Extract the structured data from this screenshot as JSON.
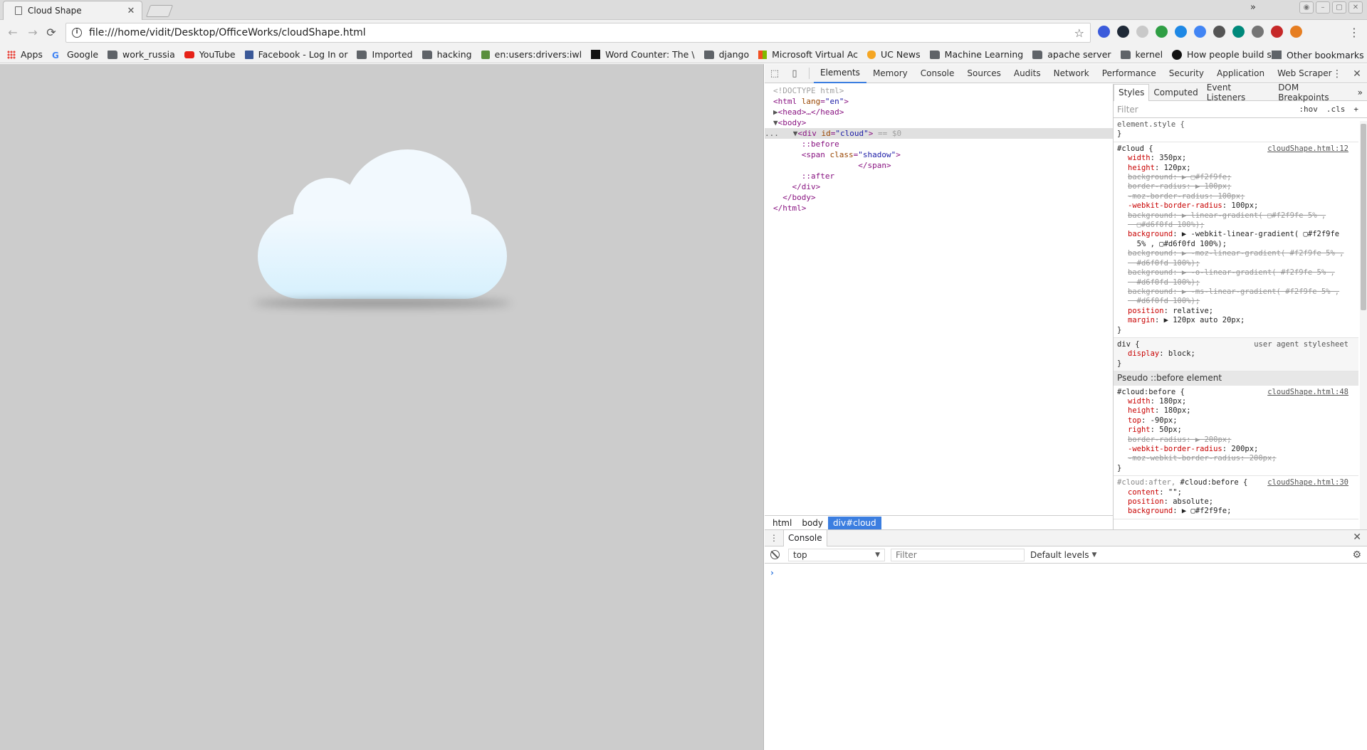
{
  "browser": {
    "tab_title": "Cloud Shape",
    "tab_close_glyph": "✕",
    "url": "file:///home/vidit/Desktop/OfficeWorks/cloudShape.html",
    "back_glyph": "←",
    "forward_glyph": "→",
    "reload_glyph": "⟳",
    "star_glyph": "☆",
    "menu_glyph": "⋮",
    "window_controls": [
      "◉",
      "–",
      "▢",
      "✕"
    ],
    "extension_colors": [
      "#3b5bdb",
      "#1f2937",
      "#c9c9c9",
      "#2f9e44",
      "#1e88e5",
      "#4285f4",
      "#555555",
      "#00897b",
      "#757575",
      "#c62828",
      "#e67e22"
    ]
  },
  "bookmarks": {
    "items": [
      {
        "label": "Apps",
        "icon": "apps-icon"
      },
      {
        "label": "Google",
        "icon": "google-icon"
      },
      {
        "label": "work_russia",
        "icon": "folder-icon"
      },
      {
        "label": "YouTube",
        "icon": "youtube-icon"
      },
      {
        "label": "Facebook - Log In or",
        "icon": "facebook-icon"
      },
      {
        "label": "Imported",
        "icon": "folder-icon"
      },
      {
        "label": "hacking",
        "icon": "folder-icon"
      },
      {
        "label": "en:users:drivers:iwl",
        "icon": "wiki-icon"
      },
      {
        "label": "Word Counter: The \\",
        "icon": "wordcounter-icon"
      },
      {
        "label": "django",
        "icon": "folder-icon"
      },
      {
        "label": "Microsoft Virtual Ac",
        "icon": "microsoft-icon"
      },
      {
        "label": "UC News",
        "icon": "ucnews-icon"
      },
      {
        "label": "Machine Learning",
        "icon": "folder-icon"
      },
      {
        "label": "apache server",
        "icon": "folder-icon"
      },
      {
        "label": "kernel",
        "icon": "folder-icon"
      },
      {
        "label": "How people build so",
        "icon": "github-icon"
      }
    ],
    "more_glyph": "»",
    "other_label": "Other bookmarks"
  },
  "page": {
    "background_color": "#cccccc",
    "cloud_top_color": "#f2f9fe",
    "cloud_bottom_color": "#d6f0fd"
  },
  "devtools": {
    "tabs": [
      "Elements",
      "Memory",
      "Console",
      "Sources",
      "Audits",
      "Network",
      "Performance",
      "Security",
      "Application",
      "Web Scraper"
    ],
    "active_tab": "Elements",
    "inspect_glyph": "⬚",
    "device_glyph": "▯",
    "more_glyph": "⋮",
    "close_glyph": "✕",
    "dom": {
      "doctype": "<!DOCTYPE html>",
      "html_open_tag": "html",
      "lang_attr": "lang",
      "lang_val": "\"en\"",
      "head": "<head>…</head>",
      "body_open": "<body>",
      "div_tag": "div",
      "id_attr": "id",
      "id_val": "\"cloud\"",
      "selected_marker": "== $0",
      "before": "::before",
      "span_tag": "span",
      "class_attr": "class",
      "class_val": "\"shadow\"",
      "span_close": "</span>",
      "after": "::after",
      "div_close": "</div>",
      "body_close": "</body>",
      "html_close": "</html>",
      "ellipsis": "..."
    },
    "breadcrumbs": [
      "html",
      "body",
      "div#cloud"
    ],
    "styles": {
      "subtabs": [
        "Styles",
        "Computed",
        "Event Listeners",
        "DOM Breakpoints"
      ],
      "subtabs_more": "»",
      "filter_placeholder": "Filter",
      "hov": ":hov",
      "cls": ".cls",
      "add": "+",
      "element_style_selector": "element.style {",
      "close_brace": "}",
      "rule_cloud": {
        "selector": "#cloud {",
        "source": "cloudShape.html:12",
        "decls": [
          {
            "name": "width",
            "value": "350px;",
            "struck": false
          },
          {
            "name": "height",
            "value": "120px;",
            "struck": false
          },
          {
            "name": "background",
            "value": "▶ ▢#f2f9fe;",
            "struck": true
          },
          {
            "name": "border-radius",
            "value": "▶ 100px;",
            "struck": true
          },
          {
            "name": "-moz-border-radius",
            "value": "100px;",
            "struck": true
          },
          {
            "name": "-webkit-border-radius",
            "value": "100px;",
            "struck": false
          },
          {
            "name": "background",
            "value": "▶ linear-gradient( ▢#f2f9fe 5% ,",
            "struck": true
          },
          {
            "name": "",
            "value": "  ▢#d6f0fd 100%);",
            "struck": true
          },
          {
            "name": "background",
            "value": "▶ -webkit-linear-gradient( ▢#f2f9fe",
            "struck": false
          },
          {
            "name": "",
            "value": "  5% , ▢#d6f0fd 100%);",
            "struck": false
          },
          {
            "name": "background",
            "value": "▶ -moz-linear-gradient( #f2f9fe 5% ,",
            "struck": true
          },
          {
            "name": "",
            "value": "  #d6f0fd 100%);",
            "struck": true
          },
          {
            "name": "background",
            "value": "▶ -o-linear-gradient( #f2f9fe 5% ,",
            "struck": true
          },
          {
            "name": "",
            "value": "  #d6f0fd 100%);",
            "struck": true
          },
          {
            "name": "background",
            "value": "▶ -ms-linear-gradient( #f2f9fe 5% ,",
            "struck": true
          },
          {
            "name": "",
            "value": "  #d6f0fd 100%);",
            "struck": true
          },
          {
            "name": "position",
            "value": "relative;",
            "struck": false
          },
          {
            "name": "margin",
            "value": "▶ 120px auto 20px;",
            "struck": false
          }
        ]
      },
      "rule_div": {
        "selector": "div {",
        "source": "user agent stylesheet",
        "decls": [
          {
            "name": "display",
            "value": "block;",
            "struck": false
          }
        ]
      },
      "pseudo_before_header": "Pseudo ::before element",
      "rule_before": {
        "selector": "#cloud:before {",
        "source": "cloudShape.html:48",
        "decls": [
          {
            "name": "width",
            "value": "180px;",
            "struck": false
          },
          {
            "name": "height",
            "value": "180px;",
            "struck": false
          },
          {
            "name": "top",
            "value": "-90px;",
            "struck": false
          },
          {
            "name": "right",
            "value": "50px;",
            "struck": false
          },
          {
            "name": "border-radius",
            "value": "▶ 200px;",
            "struck": true
          },
          {
            "name": "-webkit-border-radius",
            "value": "200px;",
            "struck": false
          },
          {
            "name": "-moz-webkit-border-radius",
            "value": "200px;",
            "struck": true
          }
        ]
      },
      "rule_after_before": {
        "selector_dim": "#cloud:after,",
        "selector": " #cloud:before {",
        "source": "cloudShape.html:30",
        "decls": [
          {
            "name": "content",
            "value": "\"\";",
            "struck": false
          },
          {
            "name": "position",
            "value": "absolute;",
            "struck": false
          },
          {
            "name": "background",
            "value": "▶ ▢#f2f9fe;",
            "struck": false
          }
        ]
      }
    },
    "console": {
      "drawer_tab": "Console",
      "drawer_dots": "⋮",
      "close_glyph": "✕",
      "context": "top",
      "context_arrow": "▼",
      "filter_placeholder": "Filter",
      "levels": "Default levels",
      "levels_arrow": "▼",
      "gear_glyph": "⚙",
      "prompt": "›"
    }
  }
}
